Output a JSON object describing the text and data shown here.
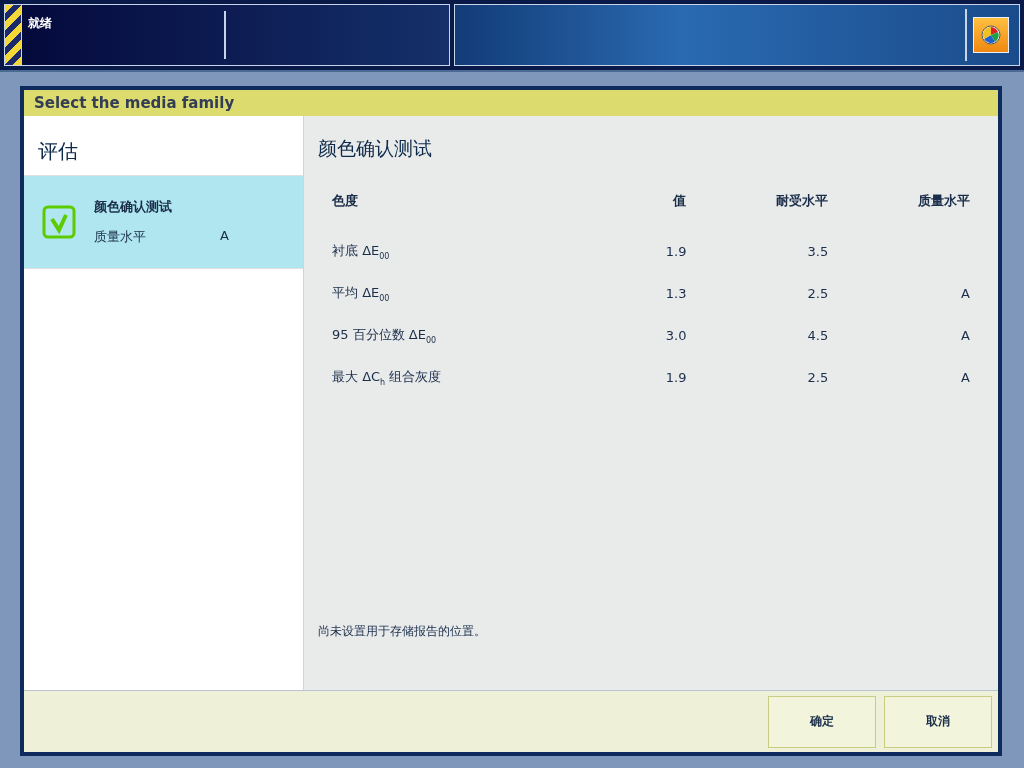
{
  "status_bar": {
    "status": "就绪"
  },
  "dialog": {
    "title": "Select the media family",
    "sidebar": {
      "heading": "评估",
      "items": [
        {
          "title": "颜色确认测试",
          "label": "质量水平",
          "value": "A",
          "checked": true,
          "selected": true
        }
      ]
    },
    "detail": {
      "title": "颜色确认测试",
      "table": {
        "columns": [
          "色度",
          "值",
          "耐受水平",
          "质量水平"
        ],
        "rows": [
          [
            "衬底 ΔE$_{00}$",
            "1.9",
            "3.5",
            ""
          ],
          [
            "平均 ΔE$_{00}$",
            "1.3",
            "2.5",
            "A"
          ],
          [
            "95 百分位数 ΔE$_{00}$",
            "3.0",
            "4.5",
            "A"
          ],
          [
            "最大 ΔC$_{h}$ 组合灰度",
            "1.9",
            "2.5",
            "A"
          ]
        ]
      },
      "note": "尚未设置用于存储报告的位置。"
    },
    "buttons": [
      "确定",
      "取消"
    ]
  }
}
